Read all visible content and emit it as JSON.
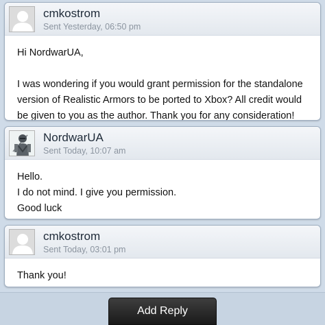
{
  "messages": [
    {
      "author": "cmkostrom",
      "sent": "Sent Yesterday, 06:50 pm",
      "avatar_icon": "default-user-silhouette",
      "lines": [
        "Hi NordwarUA,",
        "",
        "I was wondering if you would grant permission for the standalone version of Realistic Armors to be ported to Xbox? All credit would be given to you as the author. Thank you for any consideration!"
      ]
    },
    {
      "author": "NordwarUA",
      "sent": "Sent Today, 10:07 am",
      "avatar_icon": "armored-knight-avatar",
      "lines": [
        "Hello.",
        "I do not mind. I give you permission.",
        "Good luck"
      ]
    },
    {
      "author": "cmkostrom",
      "sent": "Sent Today, 03:01 pm",
      "avatar_icon": "default-user-silhouette",
      "lines": [
        "Thank you!"
      ]
    }
  ],
  "footer": {
    "reply_label": "Add Reply"
  }
}
